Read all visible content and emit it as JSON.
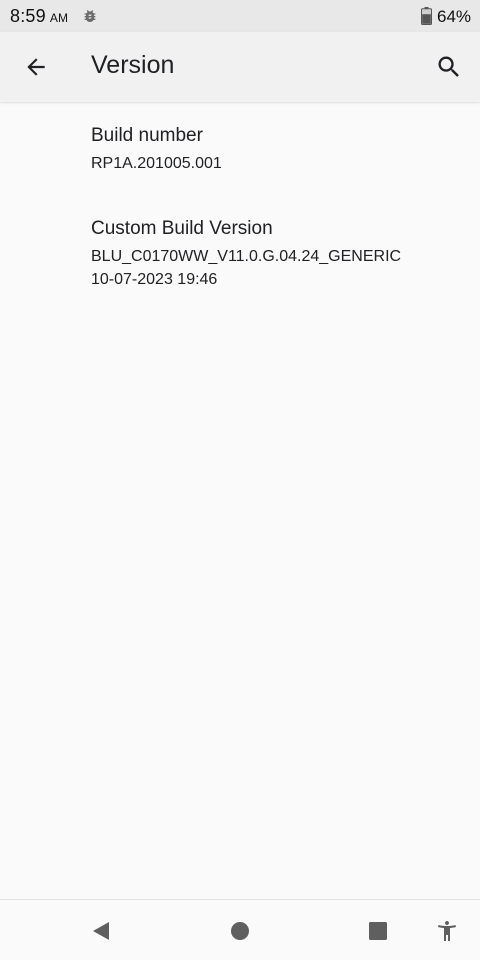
{
  "status_bar": {
    "time": "8:59",
    "ampm": "AM",
    "battery_percent": "64%",
    "icons": [
      "bug-icon",
      "battery-icon"
    ]
  },
  "app_bar": {
    "title": "Version",
    "back_icon": "arrow-back-icon",
    "search_icon": "search-icon"
  },
  "preferences": [
    {
      "title": "Build number",
      "summary_lines": [
        "RP1A.201005.001"
      ]
    },
    {
      "title": "Custom Build Version",
      "summary_lines": [
        "BLU_C0170WW_V11.0.G.04.24_GENERIC",
        "10-07-2023 19:46"
      ]
    }
  ],
  "nav_bar": {
    "icons": [
      "back-triangle-icon",
      "home-circle-icon",
      "recents-square-icon",
      "accessibility-icon"
    ]
  },
  "colors": {
    "background": "#fafafa",
    "app_bar": "#f1f1f1",
    "status_bar": "#e8e8e8",
    "text": "#202124",
    "nav_icon": "#5f5f5f"
  }
}
